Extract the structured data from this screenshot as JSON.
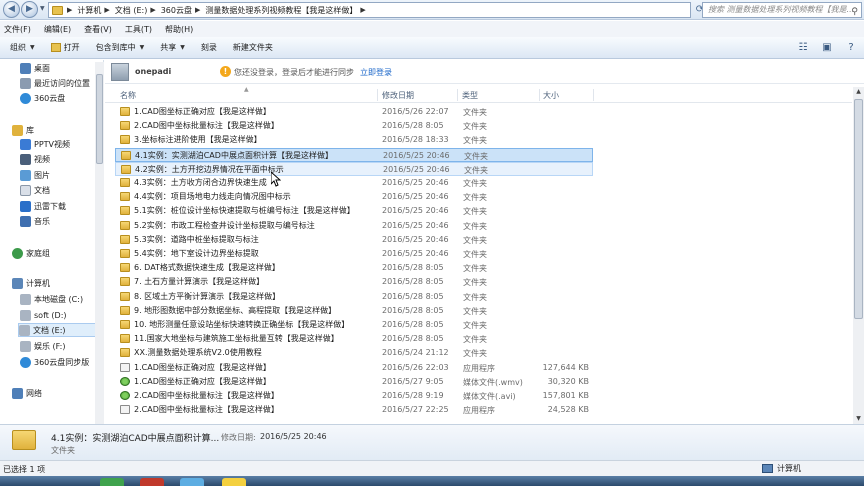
{
  "address_bar": {
    "crumbs": [
      "计算机",
      "文档 (E:)",
      "360云盘",
      "测量数据处理系列视频教程【我是这样做】"
    ],
    "search_placeholder": "搜索 测量数据处理系列视频教程【我是..."
  },
  "menubar": {
    "items": [
      "文件(F)",
      "编辑(E)",
      "查看(V)",
      "工具(T)",
      "帮助(H)"
    ]
  },
  "toolbar": {
    "organize": "组织",
    "open": "打开",
    "include_in_library": "包含到库中",
    "share": "共享",
    "burn": "刻录",
    "new_folder": "新建文件夹"
  },
  "nav": {
    "favorites": [
      "桌面",
      "最近访问的位置",
      "360云盘"
    ],
    "library_header": "库",
    "libraries": [
      "PPTV视频",
      "视频",
      "图片",
      "文档",
      "迅雷下载",
      "音乐"
    ],
    "homegroup": "家庭组",
    "computer_header": "计算机",
    "drives": [
      "本地磁盘 (C:)",
      "soft (D:)",
      "文档 (E:)",
      "娱乐 (F:)",
      "360云盘同步版"
    ],
    "network": "网络"
  },
  "userbar": {
    "username": "onepadi",
    "message": "您还没登录，登录后才能进行同步",
    "login_link": "立即登录"
  },
  "columns": {
    "name": "名称",
    "date": "修改日期",
    "type": "类型",
    "size": "大小"
  },
  "files": [
    {
      "name": "1.CAD图坐标正确对应【我是这样做】",
      "date": "2016/5/26 22:07",
      "type": "文件夹",
      "size": "",
      "kind": "folder"
    },
    {
      "name": "2.CAD图中坐标批量标注【我是这样做】",
      "date": "2016/5/28 8:05",
      "type": "文件夹",
      "size": "",
      "kind": "folder"
    },
    {
      "name": "3.坐标标注进阶使用【我是这样做】",
      "date": "2016/5/28 18:33",
      "type": "文件夹",
      "size": "",
      "kind": "folder"
    },
    {
      "name": "4.1实例：实测湖泊CAD中展点面积计算【我是这样做】",
      "date": "2016/5/25 20:46",
      "type": "文件夹",
      "size": "",
      "kind": "folder"
    },
    {
      "name": "4.2实例：土方开挖边界情况在平面中标示",
      "date": "2016/5/25 20:46",
      "type": "文件夹",
      "size": "",
      "kind": "folder"
    },
    {
      "name": "4.3实例：土方收方闭合边界快速生成",
      "date": "2016/5/25 20:46",
      "type": "文件夹",
      "size": "",
      "kind": "folder"
    },
    {
      "name": "4.4实例：项目场地电力线走向情况图中标示",
      "date": "2016/5/25 20:46",
      "type": "文件夹",
      "size": "",
      "kind": "folder"
    },
    {
      "name": "5.1实例：桩位设计坐标快速提取与桩编号标注【我是这样做】",
      "date": "2016/5/25 20:46",
      "type": "文件夹",
      "size": "",
      "kind": "folder"
    },
    {
      "name": "5.2实例：市政工程检查井设计坐标提取与编号标注",
      "date": "2016/5/25 20:46",
      "type": "文件夹",
      "size": "",
      "kind": "folder"
    },
    {
      "name": "5.3实例：道路中桩坐标提取与标注",
      "date": "2016/5/25 20:46",
      "type": "文件夹",
      "size": "",
      "kind": "folder"
    },
    {
      "name": "5.4实例：地下室设计边界坐标提取",
      "date": "2016/5/25 20:46",
      "type": "文件夹",
      "size": "",
      "kind": "folder"
    },
    {
      "name": "6. DAT格式数据快速生成【我是这样做】",
      "date": "2016/5/28 8:05",
      "type": "文件夹",
      "size": "",
      "kind": "folder"
    },
    {
      "name": "7. 土石方量计算演示【我是这样做】",
      "date": "2016/5/28 8:05",
      "type": "文件夹",
      "size": "",
      "kind": "folder"
    },
    {
      "name": "8. 区域土方平衡计算演示【我是这样做】",
      "date": "2016/5/28 8:05",
      "type": "文件夹",
      "size": "",
      "kind": "folder"
    },
    {
      "name": "9. 地形图数据中部分数据坐标、高程提取【我是这样做】",
      "date": "2016/5/28 8:05",
      "type": "文件夹",
      "size": "",
      "kind": "folder"
    },
    {
      "name": "10. 地形测量任意设站坐标快速转换正确坐标【我是这样做】",
      "date": "2016/5/28 8:05",
      "type": "文件夹",
      "size": "",
      "kind": "folder"
    },
    {
      "name": "11.国家大地坐标与建筑施工坐标批量互转【我是这样做】",
      "date": "2016/5/28 8:05",
      "type": "文件夹",
      "size": "",
      "kind": "folder"
    },
    {
      "name": "XX.测量数据处理系统V2.0使用教程",
      "date": "2016/5/24 21:12",
      "type": "文件夹",
      "size": "",
      "kind": "folder"
    },
    {
      "name": "1.CAD图坐标正确对应【我是这样做】",
      "date": "2016/5/26 22:03",
      "type": "应用程序",
      "size": "127,644 KB",
      "kind": "exe"
    },
    {
      "name": "1.CAD图坐标正确对应【我是这样做】",
      "date": "2016/5/27 9:05",
      "type": "媒体文件(.wmv)",
      "size": "30,320 KB",
      "kind": "video"
    },
    {
      "name": "2.CAD图中坐标批量标注【我是这样做】",
      "date": "2016/5/28 9:19",
      "type": "媒体文件(.avi)",
      "size": "157,801 KB",
      "kind": "video"
    },
    {
      "name": "2.CAD图中坐标批量标注【我是这样做】",
      "date": "2016/5/27 22:25",
      "type": "应用程序",
      "size": "24,528 KB",
      "kind": "exe"
    }
  ],
  "details": {
    "name": "4.1实例：实测湖泊CAD中展点面积计算...",
    "modified_label": "修改日期:",
    "modified_value": "2016/5/25 20:46",
    "type": "文件夹"
  },
  "status": {
    "selected": "已选择 1 项",
    "location": "计算机"
  }
}
